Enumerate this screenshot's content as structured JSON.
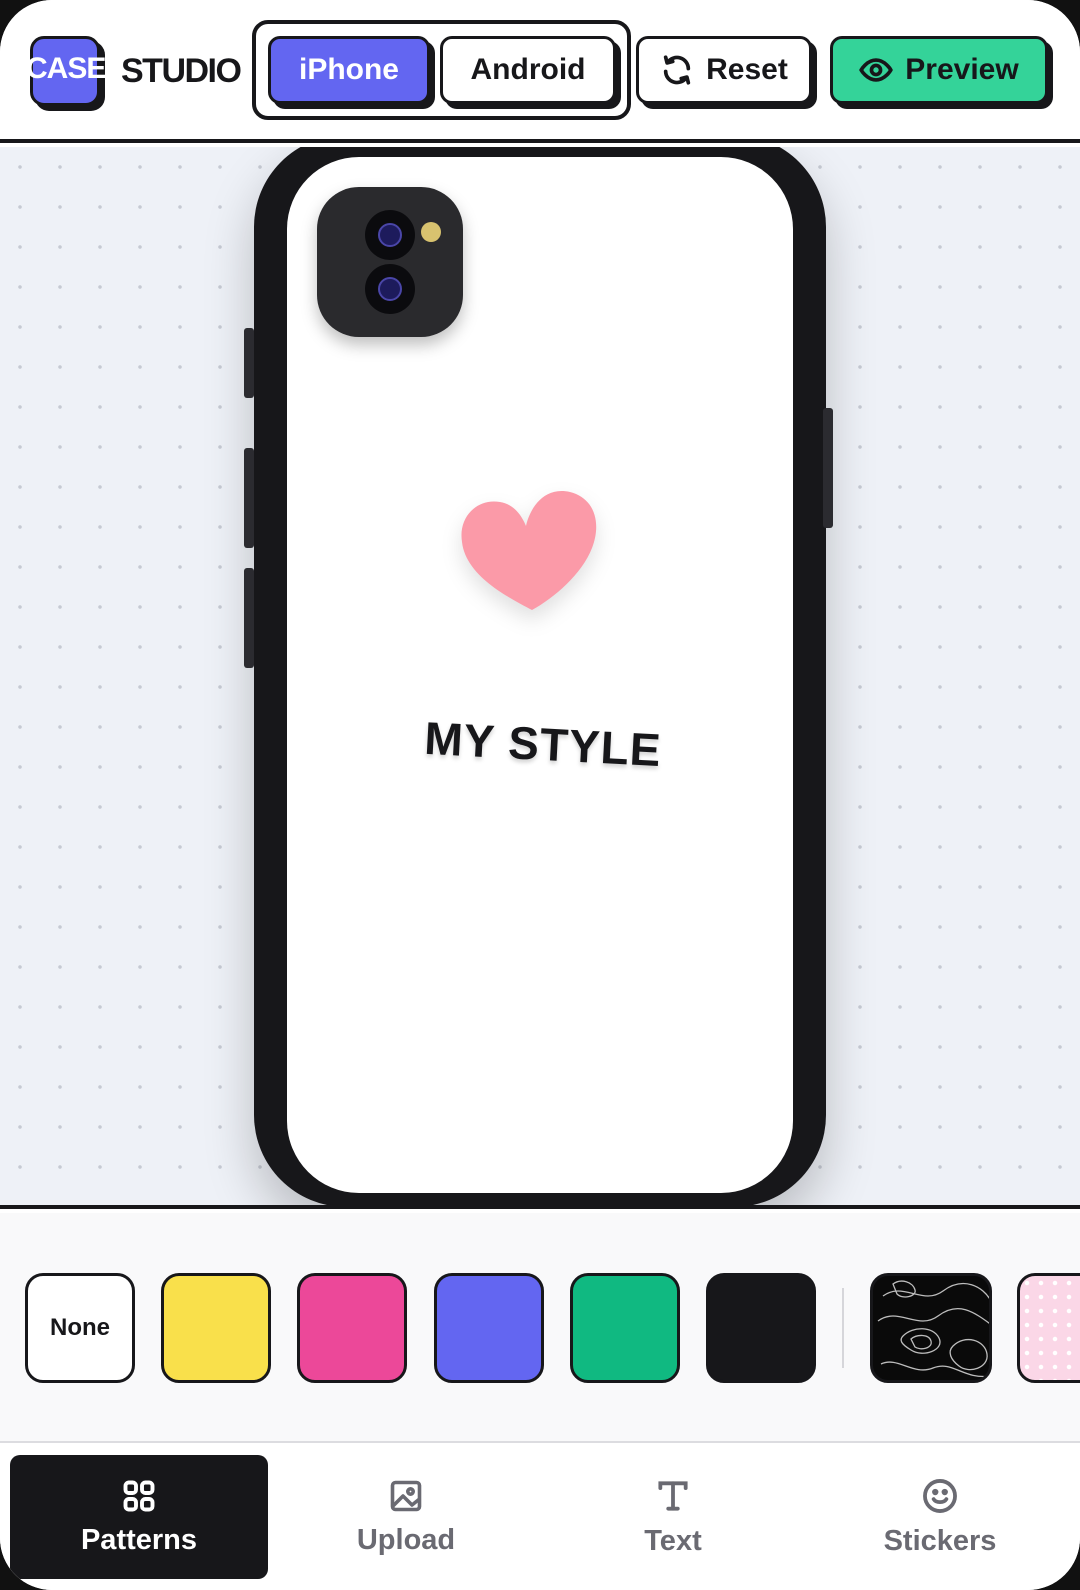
{
  "header": {
    "logo_case": "CASE",
    "logo_studio": "STUDIO",
    "device_buttons": [
      {
        "label": "iPhone",
        "selected": true
      },
      {
        "label": "Android",
        "selected": false
      }
    ],
    "reset_label": "Reset",
    "preview_label": "Preview"
  },
  "canvas": {
    "case_text": "MY STYLE",
    "sticker": "heart",
    "case_color": "#ffffff"
  },
  "swatches": {
    "none_label": "None",
    "colors": [
      "#f9e04b",
      "#ec4899",
      "#6366f1",
      "#10b981",
      "#17171a"
    ],
    "patterns": [
      "topography-pattern",
      "pink-dots-pattern"
    ]
  },
  "nav": {
    "items": [
      {
        "label": "Patterns",
        "icon": "grid-icon",
        "active": true
      },
      {
        "label": "Upload",
        "icon": "image-icon",
        "active": false
      },
      {
        "label": "Text",
        "icon": "text-icon",
        "active": false
      },
      {
        "label": "Stickers",
        "icon": "smiley-icon",
        "active": false
      }
    ]
  },
  "colors": {
    "accent": "#6366f1",
    "preview": "#34d399",
    "ink": "#17171a",
    "heart": "#fb9aa8"
  }
}
